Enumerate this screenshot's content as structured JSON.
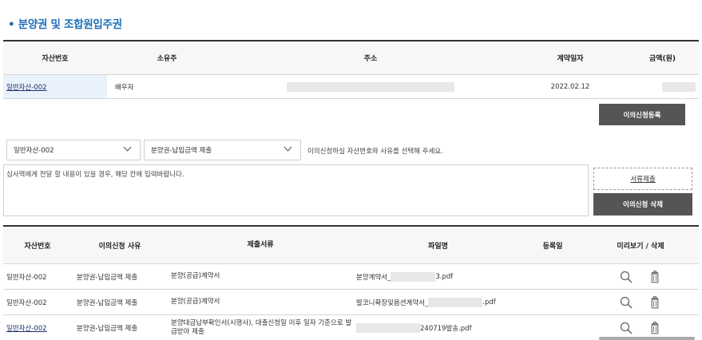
{
  "section": {
    "title": "• 분양권 및 조합원입주권"
  },
  "asset_table": {
    "headers": [
      "자산번호",
      "소유주",
      "주소",
      "계약일자",
      "금액(원)"
    ],
    "rows": [
      {
        "asset_no": "일반자산-002",
        "owner": "배우자",
        "address": "",
        "contract_date": "2022.02.12",
        "amount": ""
      }
    ]
  },
  "buttons": {
    "register": "이의신청등록",
    "submit_docs": "서류제출",
    "delete": "이의신청 삭제"
  },
  "form": {
    "asset_select": "일반자산-002",
    "reason_select": "분양권-납입금액 제출",
    "hint": "이의신청하실 자산번호와 사유를 선택해 주세요.",
    "memo_placeholder": "심사역에게 전달 할 내용이 있을 경우, 해당 칸에 입력바랍니다."
  },
  "doc_table": {
    "headers": [
      "자산번호",
      "이의신청 사유",
      "제출서류",
      "파일명",
      "등록일",
      "미리보기 / 삭제"
    ],
    "rows": [
      {
        "asset_no": "일반자산-002",
        "reason": "분양권-납입금액 제출",
        "doc": "분양(공급)계약서",
        "file_prefix": "분양계약서_",
        "file_suffix": "3.pdf",
        "date": ""
      },
      {
        "asset_no": "일반자산-002",
        "reason": "분양권-납입금액 제출",
        "doc": "분양(공급)계약서",
        "file_prefix": "발코니확장및옵션계약서_",
        "file_suffix": ".pdf",
        "date": ""
      },
      {
        "asset_no": "일반자산-002",
        "reason": "분양권-납입금액 제출",
        "doc": "분양대금납부확인서(시행사), 대출신청일 이후 일자 기준으로 발급받아 제출",
        "file_prefix": "",
        "file_suffix": "240719발송.pdf",
        "date": ""
      }
    ]
  },
  "icons": {
    "preview": "magnifier-icon",
    "delete": "trash-icon",
    "dropdown": "chevron-down-icon"
  },
  "colors": {
    "accent": "#1e6fb7",
    "button": "#555555",
    "link": "#1f2f6b"
  }
}
